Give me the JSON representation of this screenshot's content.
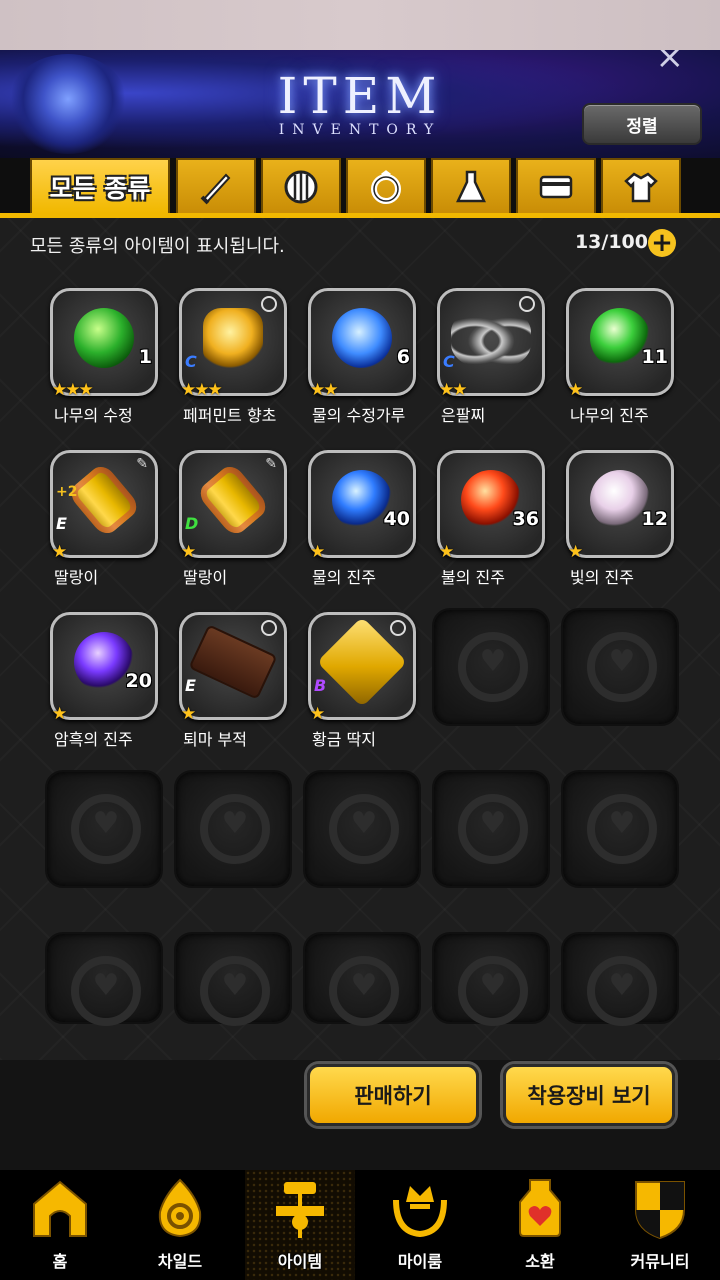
{
  "header": {
    "title": "ITEM",
    "subtitle": "INVENTORY",
    "sort_label": "정렬"
  },
  "tabs": [
    {
      "label": "모든 종류",
      "icon": "all-items"
    },
    {
      "label": "",
      "icon": "weapon-icon"
    },
    {
      "label": "",
      "icon": "armor-icon"
    },
    {
      "label": "",
      "icon": "ring-icon"
    },
    {
      "label": "",
      "icon": "potion-icon"
    },
    {
      "label": "",
      "icon": "card-icon"
    },
    {
      "label": "",
      "icon": "costume-icon"
    }
  ],
  "info": {
    "description": "모든 종류의 아이템이 표시됩니다.",
    "count": "13/100"
  },
  "items": [
    {
      "name": "나무의 수정",
      "qty": "1",
      "stars": "★★★",
      "grade": "",
      "plus": ""
    },
    {
      "name": "페퍼민트 향초",
      "qty": "",
      "stars": "★★★",
      "grade": "C",
      "plus": ""
    },
    {
      "name": "물의 수정가루",
      "qty": "6",
      "stars": "★★",
      "grade": "",
      "plus": ""
    },
    {
      "name": "은팔찌",
      "qty": "",
      "stars": "★★",
      "grade": "C",
      "plus": ""
    },
    {
      "name": "나무의 진주",
      "qty": "11",
      "stars": "★",
      "grade": "",
      "plus": ""
    },
    {
      "name": "딸랑이",
      "qty": "",
      "stars": "★",
      "grade": "E",
      "plus": "+2"
    },
    {
      "name": "딸랑이",
      "qty": "",
      "stars": "★",
      "grade": "D",
      "plus": ""
    },
    {
      "name": "물의 진주",
      "qty": "40",
      "stars": "★",
      "grade": "",
      "plus": ""
    },
    {
      "name": "불의 진주",
      "qty": "36",
      "stars": "★",
      "grade": "",
      "plus": ""
    },
    {
      "name": "빛의 진주",
      "qty": "12",
      "stars": "★",
      "grade": "",
      "plus": ""
    },
    {
      "name": "암흑의 진주",
      "qty": "20",
      "stars": "★",
      "grade": "",
      "plus": ""
    },
    {
      "name": "퇴마 부적",
      "qty": "",
      "stars": "★",
      "grade": "E",
      "plus": ""
    },
    {
      "name": "황금 딱지",
      "qty": "",
      "stars": "★",
      "grade": "B",
      "plus": ""
    }
  ],
  "actions": {
    "sell": "판매하기",
    "equipped": "착용장비 보기"
  },
  "nav": [
    {
      "label": "홈",
      "icon": "home-icon"
    },
    {
      "label": "차일드",
      "icon": "child-icon"
    },
    {
      "label": "아이템",
      "icon": "item-icon"
    },
    {
      "label": "마이룸",
      "icon": "myroom-icon"
    },
    {
      "label": "소환",
      "icon": "summon-icon"
    },
    {
      "label": "커뮤니티",
      "icon": "community-icon"
    }
  ],
  "colors": {
    "accent": "#f1b800",
    "star": "#ffc21a"
  }
}
